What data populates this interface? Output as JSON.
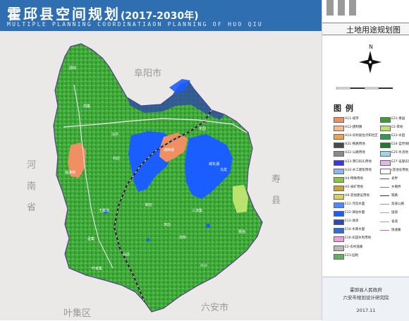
{
  "header": {
    "title": "霍邱县空间规划",
    "years": "(2017-2030年)",
    "subtitle": "MULTIPLE PLANNING COORDINATIAON PLANNING OF HUO QIU"
  },
  "map": {
    "regions": {
      "fuyang": "阜阳市",
      "henan": "河南省",
      "shou": "寿县",
      "yeji": "叶集区",
      "luan": "六安市"
    },
    "places": [
      "城西湖",
      "城东湖",
      "临淮岗",
      "周集",
      "冯井",
      "叶家集",
      "马店",
      "王截流",
      "新店",
      "孟集",
      "三流集",
      "范桥",
      "众兴",
      "乌龙",
      "曹庙",
      "宋店",
      "邵岗",
      "石店",
      "花园"
    ]
  },
  "sidebar": {
    "panel_title": "土地用途规划图",
    "north_label": "N",
    "legend_title": "图 例",
    "legend_left": [
      {
        "label": "H11-城市",
        "color": "#f08f62"
      },
      {
        "label": "H12-建制镇",
        "color": "#f6ba8e"
      },
      {
        "label": "H14-农村居住点和社区",
        "color": "#f0a24c"
      },
      {
        "label": "H21-铁路用地",
        "color": "#4a4a4a"
      },
      {
        "label": "H22-公路用地",
        "color": "#8b8b8b"
      },
      {
        "label": "H23-港口码头用地",
        "color": "#3a3ad8"
      },
      {
        "label": "H32-水工建筑用地",
        "color": "#8fb6e8"
      },
      {
        "label": "H4-特殊用地",
        "color": "#8cc63e"
      },
      {
        "label": "H5-采矿用地",
        "color": "#c9a43a"
      },
      {
        "label": "H9-其他建设用地",
        "color": "#d9cf63"
      },
      {
        "label": "E11-河流水面",
        "color": "#4a8cff"
      },
      {
        "label": "E12-湖泊水面",
        "color": "#1a5eff"
      },
      {
        "label": "E13-滩涂",
        "color": "#2f4aa8"
      },
      {
        "label": "E14-水库水面",
        "color": "#2f6ed8"
      },
      {
        "label": "E16-农田水利用地",
        "color": "#f0a0d8"
      },
      {
        "label": "E2-农村道路",
        "color": "#b9b9b9"
      },
      {
        "label": "E21-园地",
        "color": "#5fb35e"
      }
    ],
    "legend_right": [
      {
        "label": "E21-果园",
        "color": "#3e9b3a"
      },
      {
        "label": "E2-草地",
        "color": "#b9e36d"
      },
      {
        "label": "E23-水田",
        "color": "#2d9b4b"
      },
      {
        "label": "E24-自然保护",
        "color": "#1f7a2f"
      },
      {
        "label": "E25-水浇地",
        "color": "#9ed5e8"
      },
      {
        "label": "E27-设施农用",
        "color": "#e6b4e6"
      },
      {
        "label": "(其他农用地)",
        "color": "#ffffff"
      }
    ],
    "legend_lines": [
      {
        "label": "县界",
        "color": "#c0392b"
      },
      {
        "label": "乡镇界",
        "color": "#7a6fb3"
      },
      {
        "label": "铁路",
        "color": "#333333"
      },
      {
        "label": "高速公路",
        "color": "#e08080"
      },
      {
        "label": "国道",
        "color": "#d98ad1"
      },
      {
        "label": "省道",
        "color": "#8aa8d9"
      },
      {
        "label": "快速路",
        "color": "#cf5fcf"
      }
    ],
    "footer": {
      "org": "霍邱县人民政府",
      "designer": "六安市规划设计研究院",
      "date": "2017.11"
    }
  }
}
